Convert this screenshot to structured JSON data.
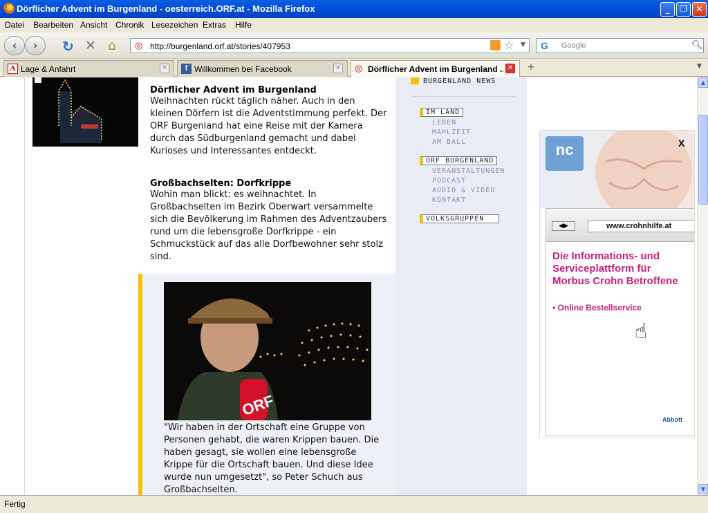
{
  "window": {
    "title": "Dörflicher Advent im Burgenland - oesterreich.ORF.at - Mozilla Firefox"
  },
  "menu": [
    "Datei",
    "Bearbeiten",
    "Ansicht",
    "Chronik",
    "Lesezeichen",
    "Extras",
    "Hilfe"
  ],
  "nav": {
    "url": "http://burgenland.orf.at/stories/407953",
    "search_placeholder": "Google"
  },
  "tabs": [
    {
      "label": "Lage & Anfahrt",
      "active": false
    },
    {
      "label": "Willkommen bei Facebook",
      "active": false
    },
    {
      "label": "Dörflicher Advent im Burgenland ...",
      "active": true
    }
  ],
  "article": {
    "heading1": "Dörflicher Advent im Burgenland",
    "para1": "Weihnachten rückt täglich näher. Auch in den kleinen Dörfern ist die Adventstimmung perfekt. Der ORF Burgenland hat eine Reise mit der Kamera durch das Südburgenland gemacht und dabei Kurioses und Interessantes entdeckt.",
    "heading2": "Großbachselten: Dorfkrippe",
    "para2": "Wohin man blickt: es weihnachtet. In Großbachselten im Bezirk Oberwart versammelte sich die Bevölkerung im Rahmen des Adventzaubers rund um die lebensgroße Dorfkrippe - ein Schmuckstück auf das alle Dorfbewohner sehr stolz sind.",
    "quote": "\"Wir haben in der Ortschaft eine Gruppe von Personen gehabt, die waren Krippen bauen. Die haben gesagt, sie wollen eine lebensgroße Krippe für die Ortschaft bauen. Und diese Idee wurde nun umgesetzt\", so Peter Schuch aus Großbachselten.",
    "mic_label": "ORF"
  },
  "sidenav": {
    "header": "BURGENLAND NEWS",
    "sections": [
      {
        "label": "IM LAND",
        "items": [
          "LEBEN",
          "MAHLZEIT",
          "AM BALL"
        ]
      },
      {
        "label": "ORF BURGENLAND",
        "items": [
          "VERANSTALTUNGEN",
          "PODCAST",
          "AUDIO & VIDEO",
          "KONTAKT"
        ]
      },
      {
        "label": "VOLKSGRUPPEN",
        "items": []
      }
    ]
  },
  "ad": {
    "close": "X",
    "url": "www.crohnhilfe.at",
    "headline": "Die Informations- und Serviceplattform für Morbus Crohn Betroffene",
    "bullet": "• Online Bestellservice",
    "brand": "Abbott"
  },
  "status": {
    "text": "Fertig"
  },
  "colors": {
    "accent_yellow": "#f2c200",
    "ad_pink": "#c8207a",
    "xp_blue": "#0a5fe0"
  }
}
